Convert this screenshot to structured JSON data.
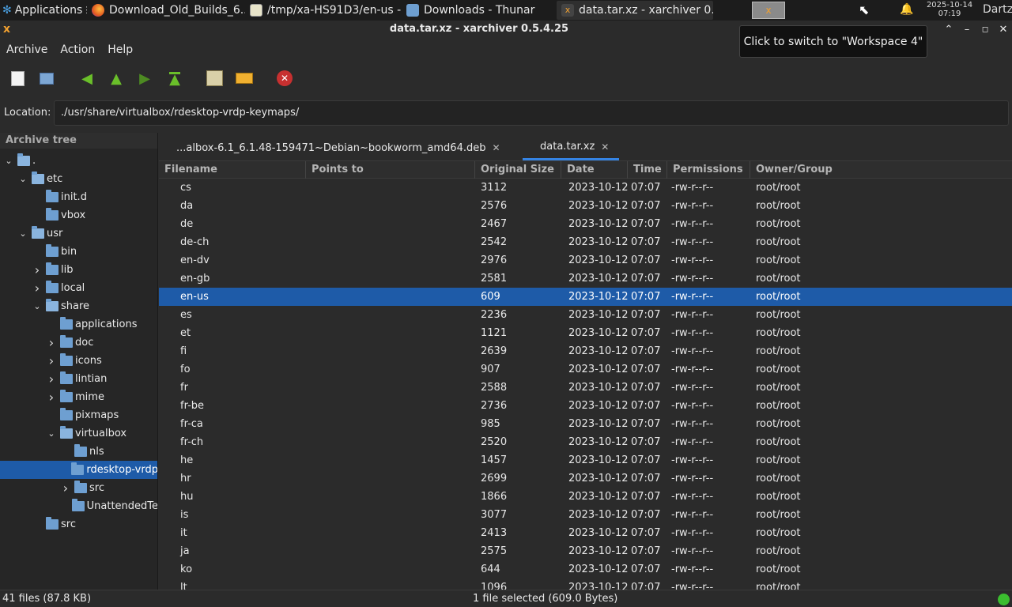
{
  "taskbar": {
    "apps_label": "Applications",
    "tasks": [
      {
        "label": "Download_Old_Builds_6...",
        "icon": "firefox-icon"
      },
      {
        "label": "/tmp/xa-HS91D3/en-us -...",
        "icon": "text-editor-icon"
      },
      {
        "label": "Downloads - Thunar",
        "icon": "folder-icon"
      },
      {
        "label": "data.tar.xz - xarchiver 0...",
        "icon": "xarchiver-icon"
      }
    ],
    "clock_date": "2025-10-14",
    "clock_time": "07:19",
    "user": "Dartz"
  },
  "tooltip": "Click to switch to \"Workspace 4\"",
  "window": {
    "title": "data.tar.xz - xarchiver 0.5.4.25"
  },
  "menu": [
    "Archive",
    "Action",
    "Help"
  ],
  "location": {
    "label": "Location:",
    "value": "./usr/share/virtualbox/rdesktop-vrdp-keymaps/"
  },
  "tree": {
    "header": "Archive tree",
    "nodes": [
      {
        "label": ".",
        "arrow": "v",
        "level": 0
      },
      {
        "label": "etc",
        "arrow": "v",
        "level": 1
      },
      {
        "label": "init.d",
        "arrow": "",
        "level": 2
      },
      {
        "label": "vbox",
        "arrow": "",
        "level": 2
      },
      {
        "label": "usr",
        "arrow": "v",
        "level": 1
      },
      {
        "label": "bin",
        "arrow": "",
        "level": 2
      },
      {
        "label": "lib",
        "arrow": ">",
        "level": 2
      },
      {
        "label": "local",
        "arrow": ">",
        "level": 2
      },
      {
        "label": "share",
        "arrow": "v",
        "level": 2
      },
      {
        "label": "applications",
        "arrow": "",
        "level": 3
      },
      {
        "label": "doc",
        "arrow": ">",
        "level": 3
      },
      {
        "label": "icons",
        "arrow": ">",
        "level": 3
      },
      {
        "label": "lintian",
        "arrow": ">",
        "level": 3
      },
      {
        "label": "mime",
        "arrow": ">",
        "level": 3
      },
      {
        "label": "pixmaps",
        "arrow": "",
        "level": 3
      },
      {
        "label": "virtualbox",
        "arrow": "v",
        "level": 3
      },
      {
        "label": "nls",
        "arrow": "",
        "level": 4
      },
      {
        "label": "rdesktop-vrdp",
        "arrow": "",
        "level": 4,
        "selected": true
      },
      {
        "label": "src",
        "arrow": ">",
        "level": 4
      },
      {
        "label": "UnattendedTe",
        "arrow": "",
        "level": 4
      },
      {
        "label": "src",
        "arrow": "",
        "level": 2
      }
    ]
  },
  "tabs": [
    {
      "label": "...albox-6.1_6.1.48-159471~Debian~bookworm_amd64.deb",
      "active": false
    },
    {
      "label": "data.tar.xz",
      "active": true
    }
  ],
  "columns": [
    "Filename",
    "Points to",
    "Original Size",
    "Date",
    "Time",
    "Permissions",
    "Owner/Group"
  ],
  "rows": [
    {
      "name": "cs",
      "size": "3112"
    },
    {
      "name": "da",
      "size": "2576"
    },
    {
      "name": "de",
      "size": "2467"
    },
    {
      "name": "de-ch",
      "size": "2542"
    },
    {
      "name": "en-dv",
      "size": "2976"
    },
    {
      "name": "en-gb",
      "size": "2581"
    },
    {
      "name": "en-us",
      "size": "609",
      "selected": true
    },
    {
      "name": "es",
      "size": "2236"
    },
    {
      "name": "et",
      "size": "1121"
    },
    {
      "name": "fi",
      "size": "2639"
    },
    {
      "name": "fo",
      "size": "907"
    },
    {
      "name": "fr",
      "size": "2588"
    },
    {
      "name": "fr-be",
      "size": "2736"
    },
    {
      "name": "fr-ca",
      "size": "985"
    },
    {
      "name": "fr-ch",
      "size": "2520"
    },
    {
      "name": "he",
      "size": "1457"
    },
    {
      "name": "hr",
      "size": "2699"
    },
    {
      "name": "hu",
      "size": "1866"
    },
    {
      "name": "is",
      "size": "3077"
    },
    {
      "name": "it",
      "size": "2413"
    },
    {
      "name": "ja",
      "size": "2575"
    },
    {
      "name": "ko",
      "size": "644"
    },
    {
      "name": "lt",
      "size": "1096"
    }
  ],
  "row_defaults": {
    "points_to": "",
    "date": "2023-10-12",
    "time": "07:07",
    "perms": "-rw-r--r--",
    "owner": "root/root"
  },
  "status": {
    "left": "41 files  (87.8 KB)",
    "mid": "1 file selected (609.0 Bytes)"
  },
  "colors": {
    "accent": "#1e5ba8",
    "tab_underline": "#3584e4",
    "led": "#3bbd2f"
  }
}
